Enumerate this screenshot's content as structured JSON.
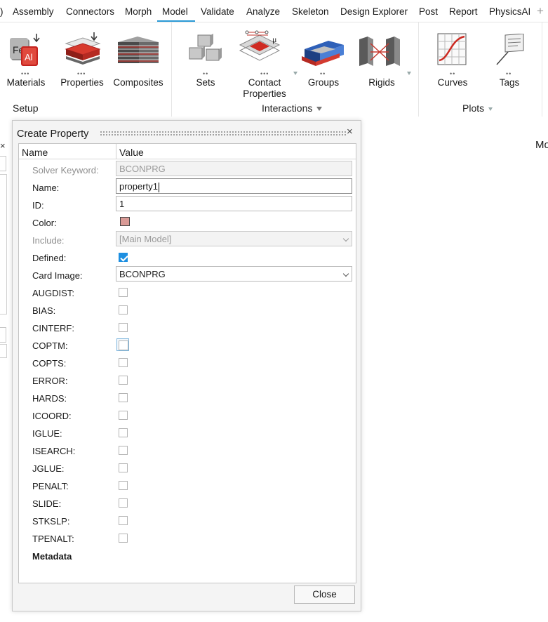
{
  "menubar": {
    "items": [
      {
        "label": "Assembly"
      },
      {
        "label": "Connectors"
      },
      {
        "label": "Morph"
      },
      {
        "label": "Model"
      },
      {
        "label": "Validate"
      },
      {
        "label": "Analyze"
      },
      {
        "label": "Skeleton"
      },
      {
        "label": "Design Explorer"
      },
      {
        "label": "Post"
      },
      {
        "label": "Report"
      },
      {
        "label": "PhysicsAI"
      }
    ],
    "active": "Model",
    "leading_fragment": ")",
    "add_icon": "plus-icon"
  },
  "ribbon": {
    "tools": [
      {
        "label": "Materials",
        "icon": "materials-icon"
      },
      {
        "label": "Properties",
        "icon": "properties-icon"
      },
      {
        "label": "Composites",
        "icon": "composites-icon"
      },
      {
        "label": "Sets",
        "icon": "sets-icon"
      },
      {
        "label": "Contact\nProperties",
        "icon": "contact-properties-icon"
      },
      {
        "label": "Groups",
        "icon": "groups-icon"
      },
      {
        "label": "Rigids",
        "icon": "rigids-icon"
      },
      {
        "label": "Curves",
        "icon": "curves-icon"
      },
      {
        "label": "Tags",
        "icon": "tags-icon"
      }
    ],
    "groups": [
      {
        "label": "Setup"
      },
      {
        "label": "Interactions"
      },
      {
        "label": "Plots"
      }
    ]
  },
  "right_fragment": "Mo",
  "dialog": {
    "title": "Create Property",
    "columns": {
      "name": "Name",
      "value": "Value"
    },
    "rows": {
      "solver_keyword": {
        "label": "Solver Keyword:",
        "value": "BCONPRG"
      },
      "name": {
        "label": "Name:",
        "value": "property1"
      },
      "id": {
        "label": "ID:",
        "value": "1"
      },
      "color": {
        "label": "Color:",
        "value": "#d99a96"
      },
      "include": {
        "label": "Include:",
        "value": "[Main Model]"
      },
      "defined": {
        "label": "Defined:",
        "checked": true
      },
      "card_image": {
        "label": "Card Image:",
        "value": "BCONPRG"
      }
    },
    "flags": [
      {
        "label": "AUGDIST:",
        "checked": false
      },
      {
        "label": "BIAS:",
        "checked": false
      },
      {
        "label": "CINTERF:",
        "checked": false
      },
      {
        "label": "COPTM:",
        "checked": false
      },
      {
        "label": "COPTS:",
        "checked": false
      },
      {
        "label": "ERROR:",
        "checked": false
      },
      {
        "label": "HARDS:",
        "checked": false
      },
      {
        "label": "ICOORD:",
        "checked": false
      },
      {
        "label": "IGLUE:",
        "checked": false
      },
      {
        "label": "ISEARCH:",
        "checked": false
      },
      {
        "label": "JGLUE:",
        "checked": false
      },
      {
        "label": "PENALT:",
        "checked": false
      },
      {
        "label": "SLIDE:",
        "checked": false
      },
      {
        "label": "STKSLP:",
        "checked": false
      },
      {
        "label": "TPENALT:",
        "checked": false
      }
    ],
    "metadata_label": "Metadata",
    "close_label": "Close"
  }
}
